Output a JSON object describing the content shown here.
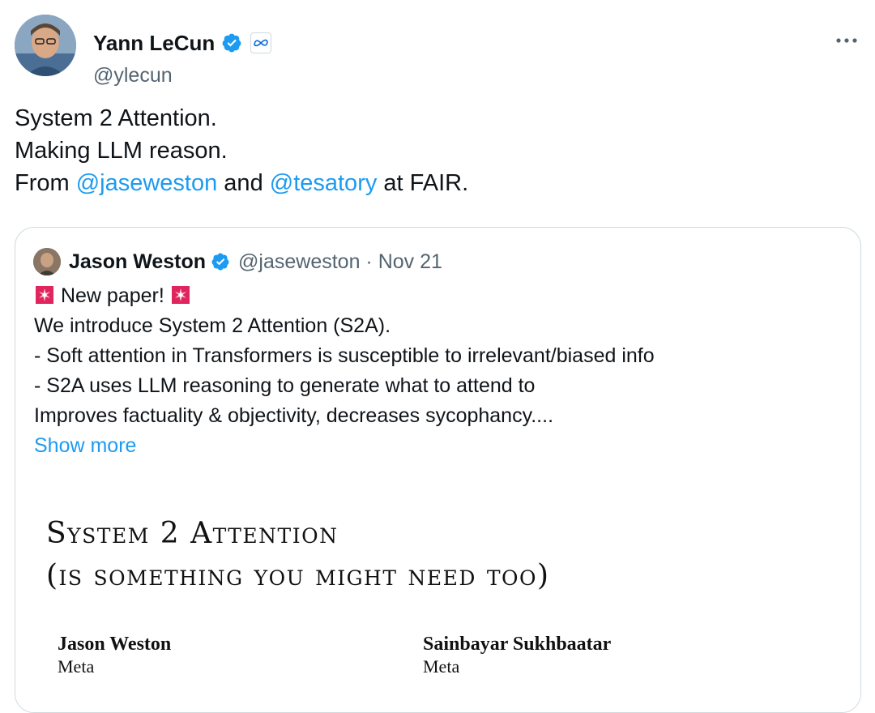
{
  "tweet": {
    "author_name": "Yann LeCun",
    "author_handle": "@ylecun",
    "more_icon": "more-horizontal-icon",
    "text": {
      "line1": "System 2 Attention.",
      "line2": "Making LLM reason.",
      "line3_from": "From ",
      "mention1": "@jaseweston",
      "line3_and": " and ",
      "mention2": "@tesatory",
      "line3_at": " at FAIR."
    },
    "accent_color": "#1d9bf0"
  },
  "quote": {
    "author_name": "Jason Weston",
    "author_handle_date": "@jaseweston · Nov 21",
    "body": {
      "line1": "New paper!",
      "line2": "We introduce System 2 Attention (S2A).",
      "line3": "- Soft attention in Transformers is susceptible to irrelevant/biased info",
      "line4": "- S2A uses LLM reasoning to generate what to attend to",
      "line5": "Improves factuality & objectivity, decreases sycophancy...."
    },
    "show_more": "Show more",
    "paper": {
      "title_line1": "System 2 Attention",
      "title_line2": "(is something you might need too)",
      "authors": [
        {
          "name": "Jason Weston",
          "affiliation": "Meta"
        },
        {
          "name": "Sainbayar Sukhbaatar",
          "affiliation": "Meta"
        }
      ]
    }
  }
}
